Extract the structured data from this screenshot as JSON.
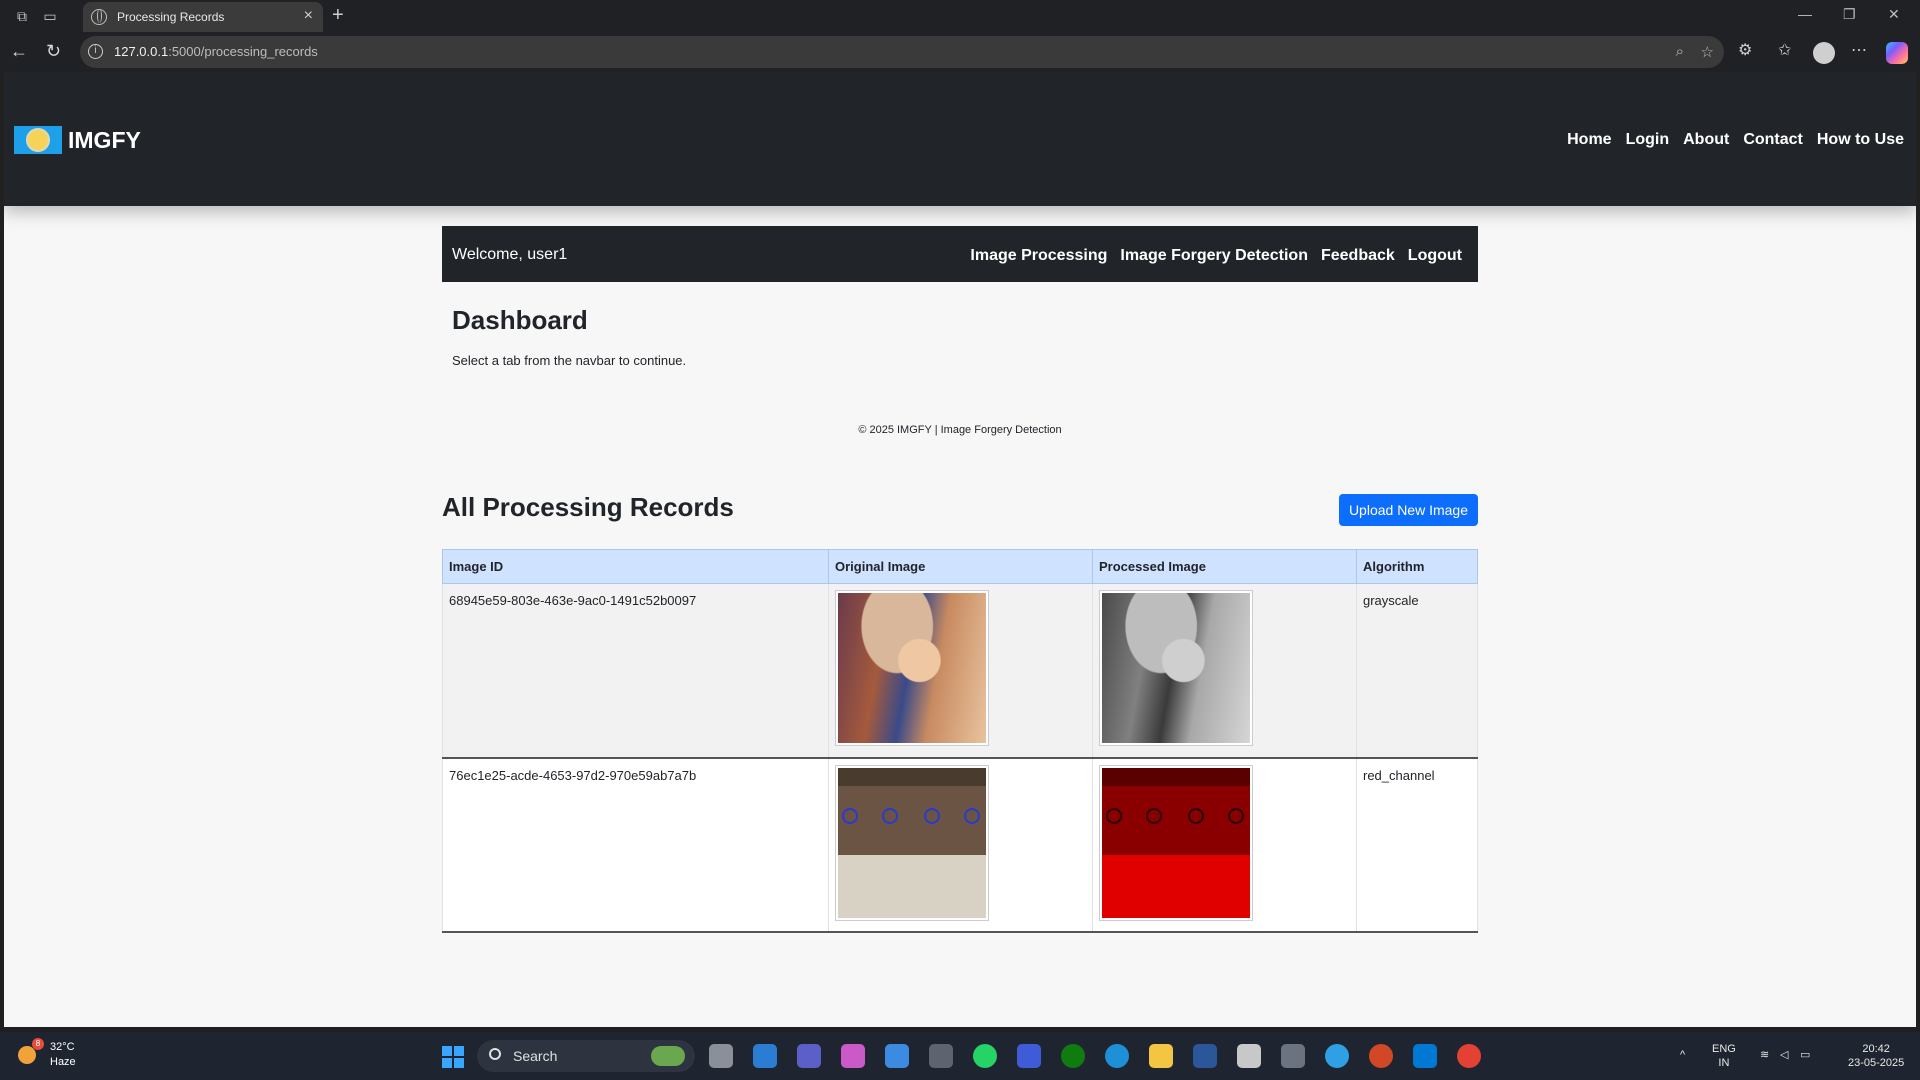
{
  "browser": {
    "tab_title": "Processing Records",
    "url_host": "127.0.0.1",
    "url_rest": ":5000/processing_records"
  },
  "site": {
    "brand": "IMGFY",
    "nav": [
      "Home",
      "Login",
      "About",
      "Contact",
      "How to Use"
    ]
  },
  "subnav": {
    "welcome": "Welcome, user1",
    "links": [
      "Image Processing",
      "Image Forgery Detection",
      "Feedback",
      "Logout"
    ]
  },
  "dashboard": {
    "title": "Dashboard",
    "text": "Select a tab from the navbar to continue.",
    "footer": "© 2025 IMGFY | Image Forgery Detection"
  },
  "records": {
    "title": "All Processing Records",
    "upload_label": "Upload New Image",
    "headers": [
      "Image ID",
      "Original Image",
      "Processed Image",
      "Algorithm"
    ],
    "rows": [
      {
        "id": "68945e59-803e-463e-9ac0-1491c52b0097",
        "algorithm": "grayscale"
      },
      {
        "id": "76ec1e25-acde-4653-97d2-970e59ab7a7b",
        "algorithm": "red_channel"
      }
    ]
  },
  "taskbar": {
    "temp": "32°C",
    "weather": "Haze",
    "weather_badge": "8",
    "search": "Search",
    "lang1": "ENG",
    "lang2": "IN",
    "time": "20:42",
    "date": "23-05-2025"
  }
}
